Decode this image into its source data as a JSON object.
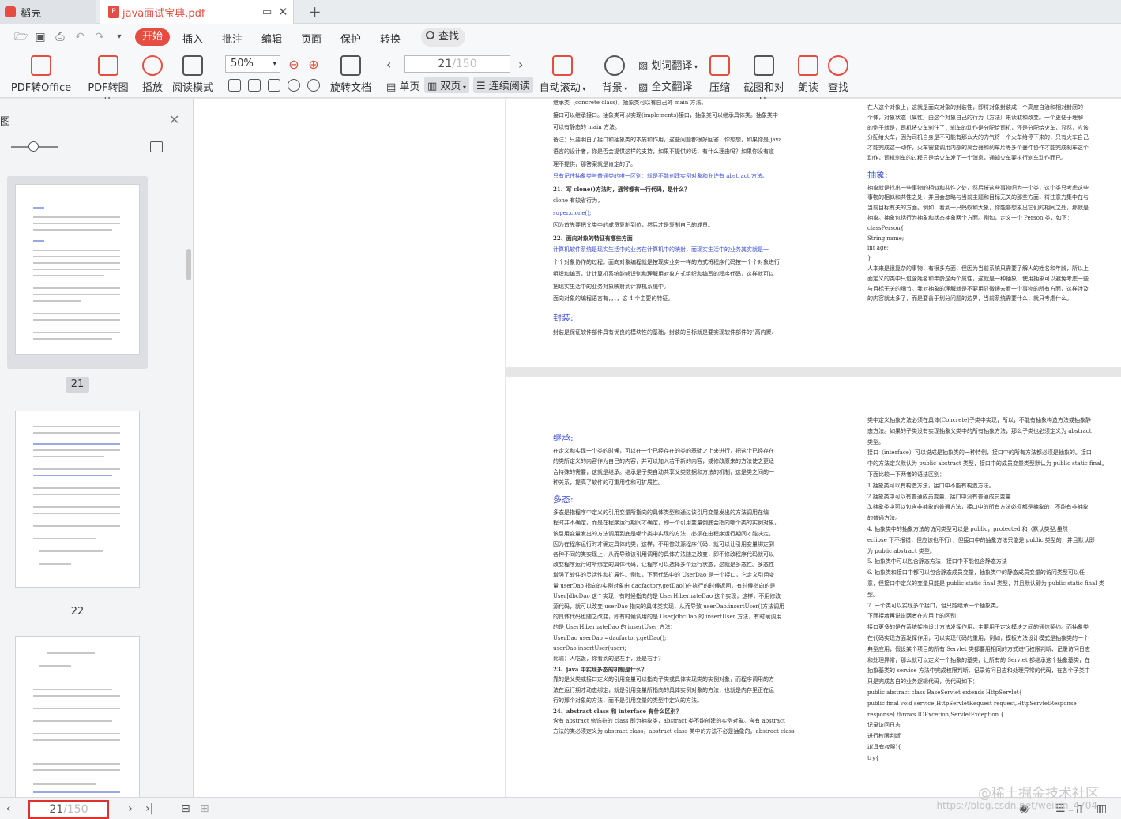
{
  "tabs": {
    "home_label": "稻壳",
    "doc_label": "java面试宝典.pdf"
  },
  "menu": {
    "items": [
      "开始",
      "插入",
      "批注",
      "编辑",
      "页面",
      "保护",
      "转换"
    ],
    "search_label": "查找"
  },
  "ribbon": {
    "pdf_to_office": "PDF转Office",
    "pdf_to_image": "PDF转图片",
    "play": "播放",
    "read_mode": "阅读模式",
    "zoom": "50%",
    "rotate": "旋转文档",
    "current_page": "21",
    "total_pages": "/150",
    "single_page": "单页",
    "double_page": "双页",
    "continuous": "连续阅读",
    "auto_scroll": "自动滚动",
    "background": "背景",
    "word_translate": "划词翻译",
    "full_translate": "全文翻译",
    "compress": "压缩",
    "screenshot_compare": "截图和对比",
    "read_aloud": "朗读",
    "find": "查找"
  },
  "left_panel": {
    "title": "图",
    "thumbnails": [
      "21",
      "22"
    ]
  },
  "document": {
    "p1_left": [
      "继承类（concrete class)，抽象类可以有自己的 main 方法。",
      "接口可以继承接口。抽象类可以实现(implements)接口，抽象类可以继承具体类。抽象类中",
      "可以有静态的 main 方法。",
      "备注：只要明白了接口和抽象类的本质和作用，这些问题都很好回答，你想想，如果你是 java",
      "语言的设计者，你是否会提供这样的支持，如果不提供的话，有什么理由吗？如果你没有道",
      "理不提供，那答案就是肯定的了。",
      "只有记住抽象类与普通类的唯一区别：就是不能创建实例对象和允许有 abstract 方法。",
      "21、写 clone()方法时，通常都有一行代码，是什么？",
      "clone 有缺省行为，",
      "super.clone();",
      "因为首先要把父类中的成员复制到位，然后才是复制自己的成员。",
      "22、面向对象的特征有哪些方面",
      "计算机软件系统是现实生活中的业务在计算机中的映射，而现实生活中的业务其实就是一",
      "个个对象协作的过程。面向对象编程就是按现实业务一样的方式将程序代码按一个个对象进行",
      "组织和编写，让计算机系统能够识别和理解用对象方式组织和编写的程序代码，这样就可以",
      "把现实生活中的业务对象映射到计算机系统中。",
      "面向对象的编程语言有，，，，这 4 个主要的特征。",
      "封装:",
      "封装是保证软件部件具有优良的模块性的基础，封装的目标就是要实现软件部件的“高内聚、"
    ],
    "p1_right": [
      "在人这个对象上，这就是面向对象的封装性，即将对象封装成一个高度自治和相对封闭的",
      "个体，对象状态（属性）由这个对象自己的行为（方法）来读取和改变。一个更便于理解",
      "的例子就是，司机将火车刹住了，刹车的动作是分配给司机，还是分配给火车，显然，应该",
      "分配给火车，因为司机自身是不可能有那么大的力气将一个火车给停下来的，只有火车自己",
      "才能完成这一动作，火车需要调用内部的离合器和刹车片等多个器件协作才能完成刹车这个",
      "动作，司机刹车的过程只是给火车发了一个消息，通知火车要执行刹车动作而已。",
      "抽象:",
      "抽象就是找出一些事物的相似和共性之处，然后将这些事物归为一个类，这个类只考虑这些",
      "事物的相似和共性之处，并且会忽略与当前主题和目标无关的那些方面，将注意力集中在与",
      "当前目标有关的方面。例如，看到一只蚂蚁和大象，你能够想象出它们的相同之处，那就是",
      "抽象。抽象包括行为抽象和状态抽象两个方面。例如，定义一个 Person 类，如下：",
      "classPerson{",
      "String name;",
      "int age;",
      "}",
      "人本来是很复杂的事物，有很多方面，但因为当前系统只需要了解人的姓名和年龄，所以上",
      "面定义的类中只包含姓名和年龄这两个属性，这就是一种抽象，使用抽象可以避免考虑一些",
      "与目标无关的细节。我对抽象的理解就是不要用显微镜去看一个事物的所有方面，这样涉及",
      "的内容就太多了，而是要善于划分问题的边界，当前系统需要什么，就只考虑什么。"
    ],
    "p2_left": [
      "继承:",
      "在定义和实现一个类的时候，可以在一个已经存在的类的基础之上来进行，把这个已经存在",
      "的类所定义的内容作为自己的内容，并可以加入若干新的内容，或修改原来的方法使之更适",
      "合特殊的需要，这就是继承。继承是子类自动共享父类数据和方法的机制，这是类之间的一",
      "种关系，提高了软件的可重用性和可扩展性。",
      "多态:",
      "多态是指程序中定义的引用变量所指向的具体类型和通过该引用变量发出的方法调用在编",
      "程时并不确定，而是在程序运行期间才确定，即一个引用变量倒底会指向哪个类的实例对象，",
      "该引用变量发出的方法调用到底是哪个类中实现的方法，必须在由程序运行期间才能决定。",
      "因为在程序运行时才确定具体的类，这样，不用修改源程序代码，就可以让引用变量绑定到",
      "各种不同的类实现上，从而导致该引用调用的具体方法随之改变，即不修改程序代码就可以",
      "改变程序运行时所绑定的具体代码，让程序可以选择多个运行状态，这就是多态性。多态性",
      "增强了软件的灵活性和扩展性。例如，下面代码中的 UserDao 是一个接口，它定义引用变",
      "量 userDao 指向的实例对象由 daofactory.getDao()在执行的时候返回，有时候指向的是",
      "UserJdbcDao 这个实现，有时候指向的是 UserHibernateDao 这个实现，这样，不用修改",
      "源代码，就可以改变 userDao 指向的具体类实现，从而导致 userDao.insertUser()方法调用",
      "的具体代码也随之改变，即有时候调用的是 UserJdbcDao 的 insertUser 方法，有时候调用",
      "的是 UserHibernateDao 的 insertUser 方法：",
      "UserDao userDao =daofactory.getDao();",
      "userDao.insertUser(user);",
      "比喻：人吃饭，你看到的是左手，还是右手？",
      "23、java 中实现多态的机制是什么？",
      "靠的是父类或接口定义的引用变量可以指向子类或具体实现类的实例对象，而程序调用的方",
      "法在运行期才动态绑定，就是引用变量所指向的具体实例对象的方法，也就是内存里正在运",
      "行的那个对象的方法，而不是引用变量的类型中定义的方法。",
      "24、abstract class 和 interface 有什么区别？",
      "含有 abstract 修饰符的 class 即为抽象类，abstract 类不能创建的实例对象。含有 abstract",
      "方法的类必须定义为 abstract class，abstract class 类中的方法不必是抽象的。abstract class"
    ],
    "p2_right": [
      "类中定义抽象方法必须在具体(Concrete)子类中实现，所以，不能有抽象构造方法或抽象静",
      "态方法。如果的子类没有实现抽象父类中的所有抽象方法，那么子类也必须定义为 abstract",
      "类型。",
      "接口（interface）可以说成是抽象类的一种特例，接口中的所有方法都必须是抽象的。接口",
      "中的方法定义默认为 public abstract 类型，接口中的成员变量类型默认为 public static final。",
      "下面比较一下两者的语法区别：",
      "1.抽象类可以有构造方法，接口中不能有构造方法。",
      "2.抽象类中可以有普通成员变量，接口中没有普通成员变量",
      "3.抽象类中可以包含非抽象的普通方法，接口中的所有方法必须都是抽象的，不能有非抽象",
      "的普通方法。",
      "4. 抽象类中的抽象方法的访问类型可以是 public，protected 和（默认类型,虽然",
      "eclipse 下不报错，但应该也不行），但接口中的抽象方法只能是 public 类型的，并且默认即",
      "为 public abstract 类型。",
      "5. 抽象类中可以包含静态方法，接口中不能包含静态方法",
      "6. 抽象类和接口中都可以包含静态成员变量，抽象类中的静态成员变量的访问类型可以任",
      "意，但接口中定义的变量只能是 public static final 类型，并且默认即为 public static final 类",
      "型。",
      "7. 一个类可以实现多个接口，但只能继承一个抽象类。",
      "下面接着再说说两者在应用上的区别：",
      "接口更多的是在系统架构设计方法发挥作用，主要用于定义模块之间的通信契约。而抽象类",
      "在代码实现方面发挥作用，可以实现代码的重用，例如，模板方法设计模式是抽象类的一个",
      "典型应用，假设某个项目的所有 Servlet 类都要用相同的方式进行权限判断、记录访问日志",
      "和处理异常，那么就可以定义一个抽象的基类，让所有的 Servlet 都继承这个抽象基类，在",
      "抽象基类的 service 方法中完成权限判断、记录访问日志和处理异常的代码，在各个子类中",
      "只是完成各自的业务逻辑代码，伪代码如下：",
      "public abstract class BaseServlet extends HttpServlet{",
      "public final void service(HttpServletRequest request,HttpServletResponse",
      "response) throws IOExcetion,ServletException {",
      "记录访问日志",
      "进行权限判断",
      "if(具有权限){",
      "try{"
    ]
  },
  "status": {
    "current_page": "21",
    "total_pages": "/150"
  },
  "watermark": "@稀土掘金技术社区",
  "watermark_url": "https://blog.csdn.net/weixin_4704"
}
